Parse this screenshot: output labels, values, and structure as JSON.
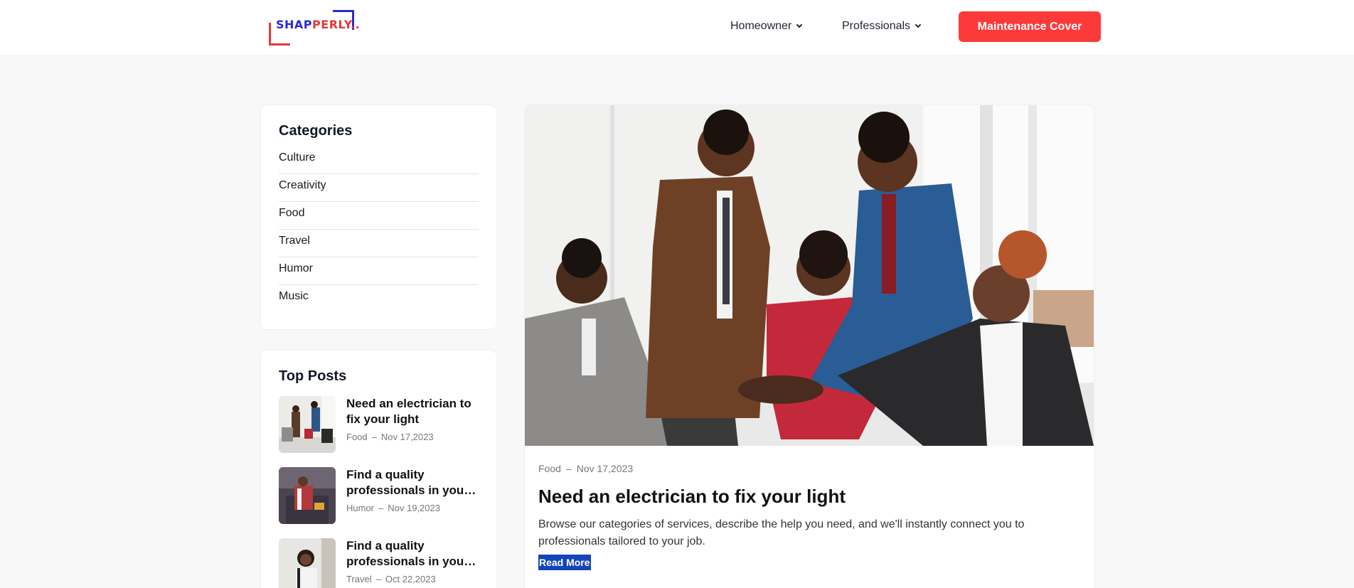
{
  "header": {
    "logo_text": "SHAPPERLY..",
    "nav": [
      {
        "label": "Homeowner"
      },
      {
        "label": "Professionals"
      }
    ],
    "cta_label": "Maintenance Cover"
  },
  "categories": {
    "title": "Categories",
    "items": [
      "Culture",
      "Creativity",
      "Food",
      "Travel",
      "Humor",
      "Music"
    ]
  },
  "top_posts": {
    "title": "Top Posts",
    "items": [
      {
        "title": "Need an electrician to fix your light",
        "category": "Food",
        "date": "Nov 17,2023"
      },
      {
        "title": "Find a quality professionals in your area",
        "category": "Humor",
        "date": "Nov 19,2023"
      },
      {
        "title": "Find a quality professionals in your area",
        "category": "Travel",
        "date": "Oct 22,2023"
      }
    ]
  },
  "featured": {
    "category": "Food",
    "date": "Nov 17,2023",
    "title": "Need an electrician to fix your light",
    "excerpt": "Browse our categories of services, describe the help you need, and we'll instantly connect you to professionals tailored to your job.",
    "read_more": "Read More"
  },
  "colors": {
    "accent_red": "#fd3a3a",
    "logo_blue": "#2a2ad8",
    "read_more_bg": "#1445b8"
  }
}
